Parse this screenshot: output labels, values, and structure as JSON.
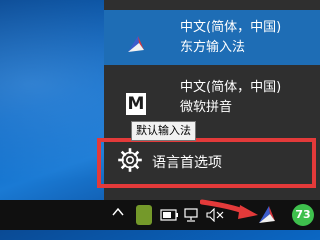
{
  "ime_menu": {
    "items": [
      {
        "line1": "中文(简体，中国)",
        "line2": "东方输入法",
        "icon": "oriental-ime-icon"
      },
      {
        "line1": "中文(简体，中国)",
        "line2": "微软拼音",
        "icon": "microsoft-pinyin-icon",
        "icon_letter": "M"
      }
    ],
    "language_options_label": "语言首选项",
    "language_options_icon": "gear-icon"
  },
  "tooltip": "默认输入法",
  "taskbar": {
    "overflow_icon": "chevron-up-icon",
    "tray_icons": [
      "green-app-icon",
      "battery-icon",
      "network-icon",
      "volume-muted-icon",
      "ime-icon"
    ],
    "badge_value": "73"
  },
  "colors": {
    "menu_bg": "#2f2f2f",
    "selected_bg": "#1e6db5",
    "highlight_box": "#e33a3a",
    "badge": "#3ec04d"
  }
}
